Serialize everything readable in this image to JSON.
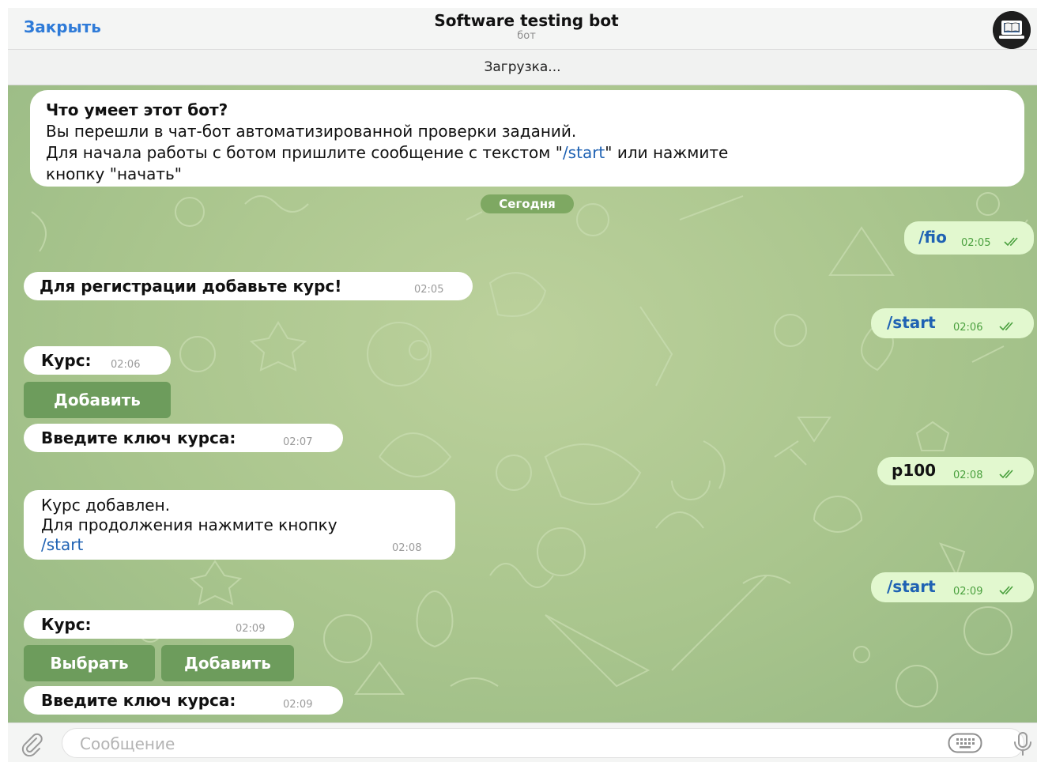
{
  "header": {
    "close_label": "Закрыть",
    "title": "Software testing bot",
    "subtitle": "бот"
  },
  "status": {
    "loading": "Загрузка..."
  },
  "intro": {
    "heading": "Что умеет этот бот?",
    "line1": "Вы перешли в чат-бот автоматизированной проверки заданий.",
    "line2_pre": "Для начала работы с ботом пришлите сообщение с текстом \"",
    "line2_link": "/start",
    "line2_post": "\" или нажмите",
    "line3": "кнопку \"начать\""
  },
  "date_divider": "Сегодня",
  "messages": [
    {
      "text": "/fio",
      "time": "02:05"
    },
    {
      "text": "Для регистрации добавьте курс!",
      "time": "02:05"
    },
    {
      "text": "/start",
      "time": "02:06"
    },
    {
      "text": "Курс:",
      "time": "02:06"
    },
    {
      "text": "Введите ключ курса:",
      "time": "02:07"
    },
    {
      "text": "p100",
      "time": "02:08"
    },
    {
      "line1": "Курс добавлен.",
      "line2": "Для продолжения нажмите кнопку",
      "link": "/start",
      "time": "02:08"
    },
    {
      "text": "/start",
      "time": "02:09"
    },
    {
      "text": "Курс:",
      "time": "02:09"
    },
    {
      "text": "Введите ключ курса:",
      "time": "02:09"
    }
  ],
  "keyboard1": {
    "add_label": "Добавить"
  },
  "keyboard2": {
    "choose_label": "Выбрать",
    "add_label": "Добавить"
  },
  "composer": {
    "placeholder": "Сообщение"
  },
  "colors": {
    "accent": "#2f7bd8",
    "chat_background": "#a9c58d",
    "incoming_bubble": "#ffffff",
    "outgoing_bubble": "#e2f8cf",
    "inline_button": "#6d9c5c"
  },
  "icons": [
    "paperclip-icon",
    "keyboard-icon",
    "microphone-icon",
    "read-checkmarks-icon",
    "bot-avatar-icon"
  ]
}
